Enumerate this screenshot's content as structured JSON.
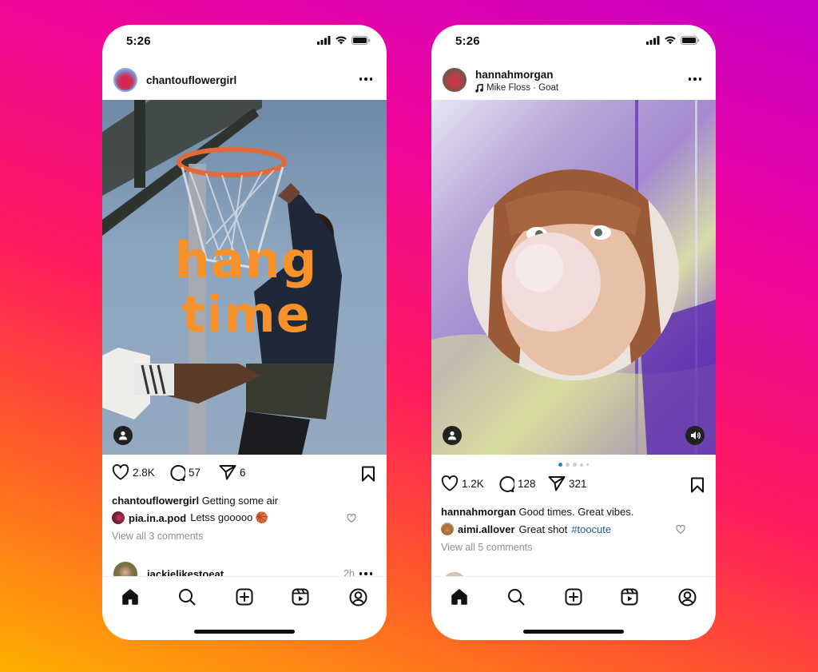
{
  "phones": [
    {
      "status": {
        "time": "5:26"
      },
      "post": {
        "username": "chantouflowergirl",
        "overlay_text": [
          "hang",
          "time"
        ],
        "likes": "2.8K",
        "comments": "57",
        "shares": "6",
        "caption_user": "chantouflowergirl",
        "caption_text": "Getting some air",
        "comment_user": "pia.in.a.pod",
        "comment_text": "Letss gooooo 🏀",
        "view_all": "View all 3 comments"
      },
      "next_post": {
        "username": "jackielikestoeat",
        "time": "2h"
      }
    },
    {
      "status": {
        "time": "5:26"
      },
      "post": {
        "username": "hannahmorgan",
        "audio": "Mike Floss · Goat",
        "likes": "1.2K",
        "comments": "128",
        "shares": "321",
        "caption_user": "hannahmorgan",
        "caption_text": "Good times. Great vibes.",
        "comment_user": "aimi.allover",
        "comment_text": "Great shot",
        "comment_hashtag": "#toocute",
        "view_all": "View all 5 comments",
        "carousel_total": 5,
        "carousel_active": 1
      }
    }
  ],
  "colors": {
    "accent_blue": "#1a8cd8",
    "overlay_orange": "#f7922a",
    "hashtag": "#1e5a8e"
  }
}
